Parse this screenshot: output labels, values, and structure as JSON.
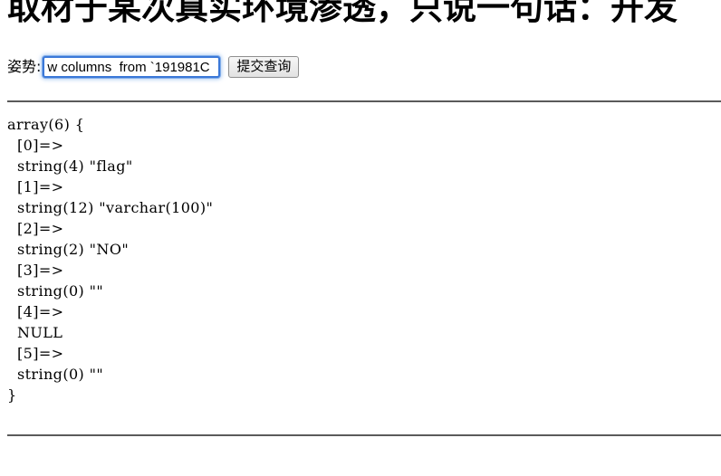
{
  "page": {
    "headline": "取材于某次真实环境渗透，只说一句话：开发",
    "background_color": "#ffffff",
    "text_color": "#000000"
  },
  "form": {
    "label": "姿势:",
    "input": {
      "name": "query-input",
      "value": "w columns  from `191981C",
      "placeholder": "",
      "focused": true,
      "caret_after": "w columns  from",
      "border_color": "#3b78d8",
      "focus_glow_color": "#78aaeb"
    },
    "submit_label": "提交查询"
  },
  "rules": {
    "color": "#5a5a5a",
    "top_label": "divider-top",
    "bottom_label": "divider-bottom"
  },
  "output": {
    "title": "var-dump-output",
    "lines": [
      "array(6) {",
      "  [0]=>",
      "  string(4) \"flag\"",
      "  [1]=>",
      "  string(12) \"varchar(100)\"",
      "  [2]=>",
      "  string(2) \"NO\"",
      "  [3]=>",
      "  string(0) \"\"",
      "  [4]=>",
      "  NULL",
      "  [5]=>",
      "  string(0) \"\"",
      "}"
    ],
    "text": "array(6) {\n  [0]=>\n  string(4) \"flag\"\n  [1]=>\n  string(12) \"varchar(100)\"\n  [2]=>\n  string(2) \"NO\"\n  [3]=>\n  string(0) \"\"\n  [4]=>\n  NULL\n  [5]=>\n  string(0) \"\"\n}",
    "array_count": 6,
    "entries": [
      {
        "index": "[0]",
        "type": "string",
        "length": 4,
        "value": "flag"
      },
      {
        "index": "[1]",
        "type": "string",
        "length": 12,
        "value": "varchar(100)"
      },
      {
        "index": "[2]",
        "type": "string",
        "length": 2,
        "value": "NO"
      },
      {
        "index": "[3]",
        "type": "string",
        "length": 0,
        "value": ""
      },
      {
        "index": "[4]",
        "type": "NULL",
        "length": null,
        "value": null
      },
      {
        "index": "[5]",
        "type": "string",
        "length": 0,
        "value": ""
      }
    ]
  }
}
